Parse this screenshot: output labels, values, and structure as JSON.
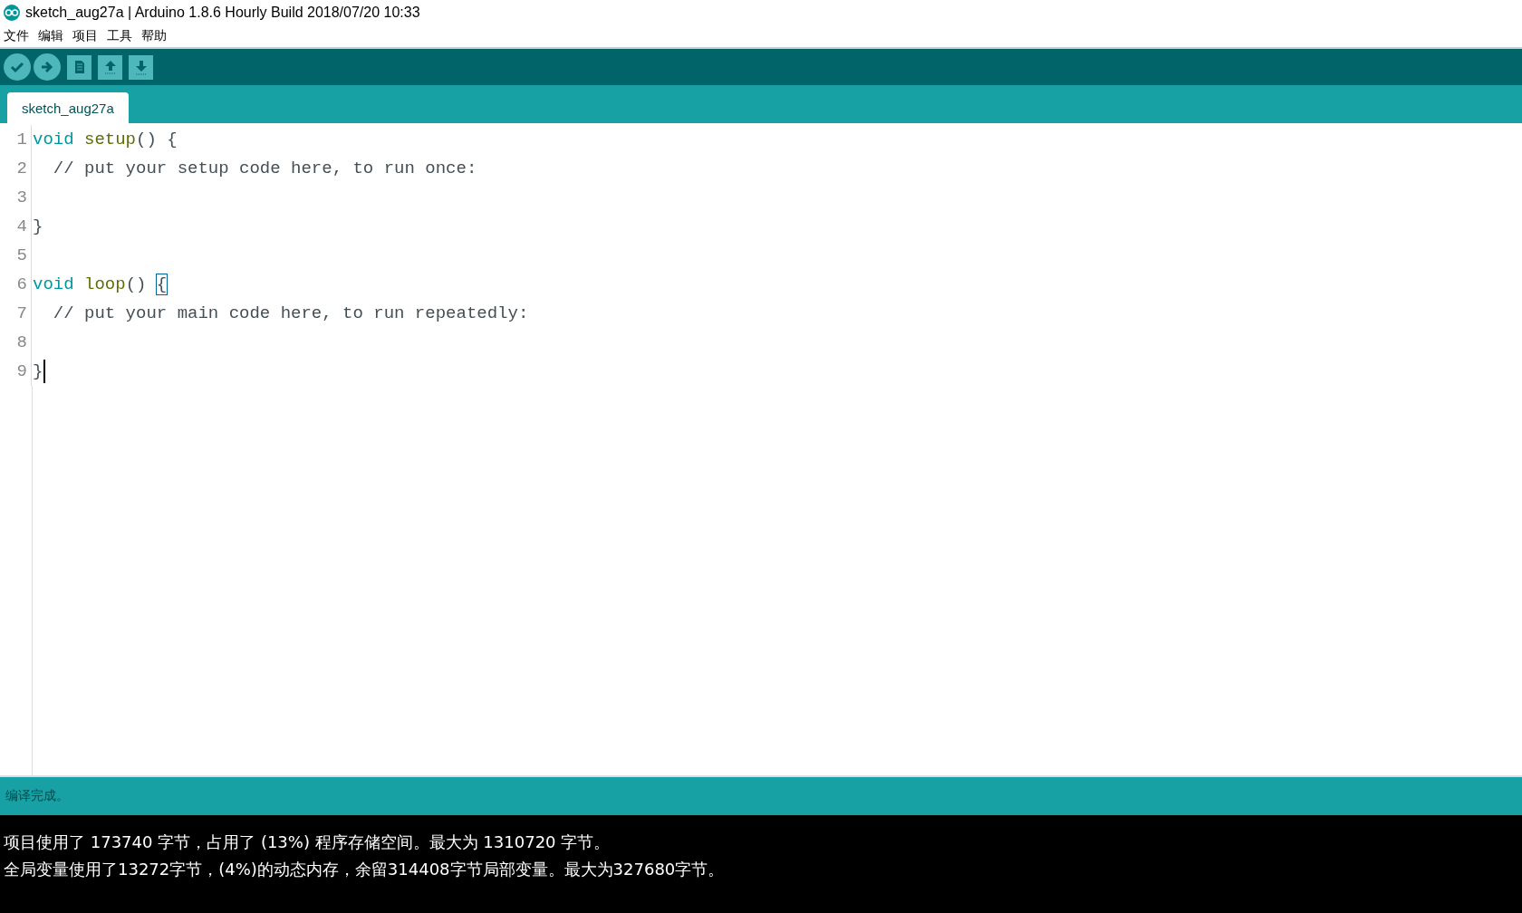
{
  "window": {
    "title": "sketch_aug27a | Arduino 1.8.6 Hourly Build 2018/07/20 10:33"
  },
  "menu": [
    "文件",
    "编辑",
    "项目",
    "工具",
    "帮助"
  ],
  "toolbar": [
    {
      "kind": "verify"
    },
    {
      "kind": "upload"
    },
    {
      "kind": "new"
    },
    {
      "kind": "open"
    },
    {
      "kind": "save"
    }
  ],
  "tabs": [
    {
      "label": "sketch_aug27a",
      "selected": true
    }
  ],
  "editor": {
    "lines": [
      {
        "number": "1",
        "cursor": false,
        "tokens": [
          {
            "kind": "keyword",
            "text": "void"
          },
          {
            "kind": "function",
            "text": " setup"
          },
          {
            "kind": "plain",
            "text": "() "
          },
          {
            "kind": "brace",
            "text": "{"
          }
        ]
      },
      {
        "number": "2",
        "cursor": false,
        "tokens": [
          {
            "kind": "comment",
            "text": "  // put your setup code here, to run once:"
          }
        ]
      },
      {
        "number": "3",
        "cursor": false
      },
      {
        "number": "4",
        "cursor": false,
        "tokens": [
          {
            "kind": "plain",
            "text": "}"
          }
        ]
      },
      {
        "number": "5",
        "cursor": false
      },
      {
        "number": "6",
        "cursor": false,
        "tokens": [
          {
            "kind": "keyword",
            "text": "void"
          },
          {
            "kind": "function",
            "text": " loop"
          },
          {
            "kind": "plain",
            "text": "() "
          },
          {
            "kind": "matched-brace",
            "text": "{"
          }
        ]
      },
      {
        "number": "7",
        "cursor": false,
        "tokens": [
          {
            "kind": "comment",
            "text": "  // put your main code here, to run repeatedly:"
          }
        ]
      },
      {
        "number": "8",
        "cursor": false
      },
      {
        "number": "9",
        "cursor": true,
        "tokens": [
          {
            "kind": "plain",
            "text": "}"
          }
        ]
      }
    ]
  },
  "status_bar": {
    "message": "编译完成。"
  },
  "console": {
    "lines": [
      "项目使用了 173740 字节，占用了 (13%) 程序存储空间。最大为 1310720 字节。",
      "全局变量使用了13272字节，(4%)的动态内存，余留314408字节局部变量。最大为327680字节。"
    ]
  }
}
